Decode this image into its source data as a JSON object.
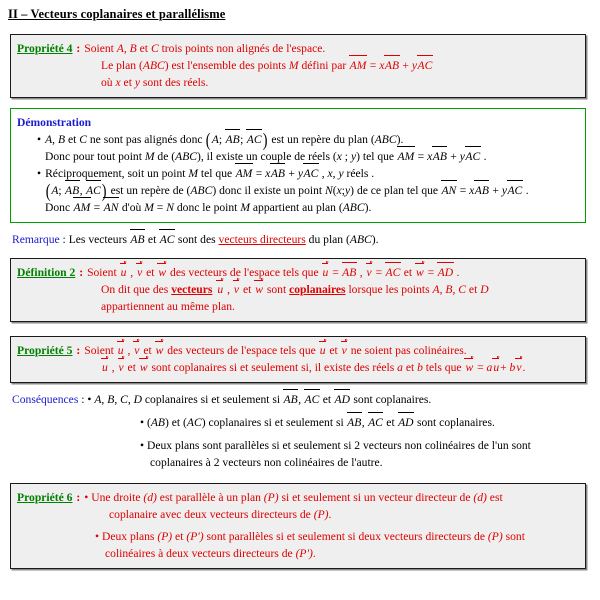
{
  "document": {
    "title": "II – Vecteurs coplanaires et parallélisme",
    "colors": {
      "label_green": "#008000",
      "body_red": "#e00000",
      "accent_blue": "#1a1ad0",
      "text_black": "#000000",
      "box_background": "#efefef",
      "box_border": "#1a1a1a",
      "demo_border": "#00a000"
    }
  },
  "propriete4": {
    "label": "Propriété 4",
    "colon": " :",
    "line1_a": "Soient ",
    "line1_A": "A",
    "line1_b": ", ",
    "line1_B": "B",
    "line1_c": " et ",
    "line1_C": "C",
    "line1_d": " trois points non alignés de l'espace.",
    "line2_a": "Le plan (",
    "line2_ABC": "ABC",
    "line2_b": ") est l'ensemble des points ",
    "line2_M": "M",
    "line2_c": " défini par ",
    "line2_AM": "AM",
    "line2_eq": " = ",
    "line2_x": "x",
    "line2_AB": "AB",
    "line2_plus": " + ",
    "line2_y": "y",
    "line2_AC": "AC",
    "line3_a": "où ",
    "line3_x": "x",
    "line3_b": " et ",
    "line3_y": "y",
    "line3_c": " sont des réels."
  },
  "demonstration": {
    "heading": "Démonstration",
    "b1_bullet": "•",
    "b1_A": "A",
    "b1_a": ", ",
    "b1_B": "B",
    "b1_b": " et ",
    "b1_C": "C",
    "b1_c": " ne sont pas alignés donc ",
    "b1_rep_A": "A",
    "b1_rep_semi1": "; ",
    "b1_rep_AB": "AB",
    "b1_rep_semi2": "; ",
    "b1_rep_AC": "AC",
    "b1_d": " est un repère du plan (",
    "b1_ABC": "ABC",
    "b1_e": ").",
    "b2_a": "Donc pour tout point ",
    "b2_M": "M",
    "b2_b": " de (",
    "b2_ABC": "ABC",
    "b2_c": "), il existe un couple de réels (",
    "b2_x": "x",
    "b2_semi": " ; ",
    "b2_y": "y",
    "b2_d": ") tel que ",
    "b2_AM": "AM",
    "b2_eq": " = ",
    "b2_xs": "x",
    "b2_AB": "AB",
    "b2_plus": " + ",
    "b2_ys": "y",
    "b2_AC": "AC",
    "b2_end": " .",
    "b3_bullet": "•",
    "b3_a": "Réciproquement, soit un point ",
    "b3_M": "M",
    "b3_b": " tel que ",
    "b3_AM": "AM",
    "b3_eq": " = ",
    "b3_x": "x",
    "b3_AB": "AB",
    "b3_plus": " + ",
    "b3_y": "y",
    "b3_AC": "AC",
    "b3_c": " , ",
    "b3_xs": "x",
    "b3_comma": ", ",
    "b3_ys": "y",
    "b3_d": " réels .",
    "b4_rep_A": "A",
    "b4_rep_semi1": "; ",
    "b4_rep_AB": "AB",
    "b4_rep_semi2": ", ",
    "b4_rep_AC": "AC",
    "b4_a": " est un repère de (",
    "b4_ABC": "ABC",
    "b4_b": ") donc il existe un point ",
    "b4_N": "N",
    "b4_c": "(",
    "b4_x": "x",
    "b4_semi": ";",
    "b4_y": "y",
    "b4_d": ")",
    "b4_e": " de ce plan tel que ",
    "b4_AN": "AN",
    "b4_eq": " = ",
    "b4_xs": "x",
    "b4_AB": "AB",
    "b4_plus": " + ",
    "b4_ys": "y",
    "b4_AC": "AC",
    "b4_end": " .",
    "b5_a": "Donc ",
    "b5_AM": "AM",
    "b5_eq": " = ",
    "b5_AN": "AN",
    "b5_b": "  d'où   ",
    "b5_M": "M",
    "b5_eq2": " = ",
    "b5_N": "N",
    "b5_c": " donc le point ",
    "b5_Ms": "M",
    "b5_d": " appartient au plan (",
    "b5_ABC": "ABC",
    "b5_e": ")."
  },
  "remarque": {
    "label": "Remarque",
    "colon": " : ",
    "a": "Les vecteurs ",
    "AB": "AB",
    "b": " et ",
    "AC": "AC",
    "c": " sont des ",
    "underlined": "vecteurs directeurs",
    "d": " du plan (",
    "ABC": "ABC",
    "e": ")."
  },
  "definition2": {
    "label": "Définition 2",
    "colon": " :",
    "l1_a": "Soient ",
    "l1_u": "u",
    "l1_c1": " , ",
    "l1_v": "v",
    "l1_b": " et ",
    "l1_w": "w",
    "l1_c": "  des vecteurs de l'espace tels que ",
    "l1_u2": "u",
    "l1_eq1": " = ",
    "l1_AB": "AB",
    "l1_c2": " , ",
    "l1_v2": "v",
    "l1_eq2": " = ",
    "l1_AC": "AC",
    "l1_d": " et ",
    "l1_w2": "w",
    "l1_eq3": " = ",
    "l1_AD": "AD",
    "l1_end": " .",
    "l2_a": "On dit que des ",
    "l2_vecteurs": "vecteurs",
    "l2_sp": " ",
    "l2_u": "u",
    "l2_c1": " , ",
    "l2_v": "v",
    "l2_b": " et ",
    "l2_w": "w",
    "l2_c": " sont ",
    "l2_coplanaires": "coplanaires",
    "l2_d": " lorsque les points ",
    "l2_A": "A",
    "l2_c2": ", ",
    "l2_B": "B",
    "l2_c3": ", ",
    "l2_C": "C",
    "l2_e": " et ",
    "l2_D": "D",
    "l3": "appartiennent au même plan."
  },
  "propriete5": {
    "label": "Propriété 5",
    "colon": " :",
    "l1_a": "Soient ",
    "l1_u": "u",
    "l1_c1": " , ",
    "l1_v": "v",
    "l1_b": " et ",
    "l1_w": "w",
    "l1_c": "  des vecteurs de l'espace tels que ",
    "l1_u2": "u",
    "l1_d": " et ",
    "l1_v2": "v",
    "l1_e": " ne soient pas colinéaires.",
    "l2_u": "u",
    "l2_c1": " , ",
    "l2_v": "v",
    "l2_a": " et ",
    "l2_w": "w",
    "l2_b": "  sont coplanaires si et seulement si, il existe des réels ",
    "l2_aa": "a",
    "l2_c": " et ",
    "l2_bb": "b",
    "l2_d": " tels que ",
    "l2_w2": "w",
    "l2_eq": " = ",
    "l2_a3": "a",
    "l2_u3": "u",
    "l2_plus": "+ ",
    "l2_b3": "b",
    "l2_v3": "v",
    "l2_end": "."
  },
  "consequences": {
    "label": "Conséquences",
    "colon": " : ",
    "b1_bullet": "•",
    "b1_a": " ",
    "b1_A": "A",
    "b1_c1": ", ",
    "b1_B": "B",
    "b1_c2": ", ",
    "b1_C": "C",
    "b1_c3": ", ",
    "b1_D": "D",
    "b1_b": " coplanaires si et seulement si ",
    "b1_AB": "AB",
    "b1_c4": ", ",
    "b1_AC": "AC",
    "b1_c": " et ",
    "b1_AD": "AD",
    "b1_d": " sont coplanaires.",
    "b2_bullet": "•",
    "b2_a": " (",
    "b2_AB": "AB",
    "b2_b": ") et (",
    "b2_AC": "AC",
    "b2_c": ") coplanaires si et seulement si ",
    "b2_v1": "AB",
    "b2_c1": ", ",
    "b2_v2": "AC",
    "b2_d": " et ",
    "b2_v3": "AD",
    "b2_e": " sont coplanaires.",
    "b3_bullet": "•",
    "b3_line1": " Deux plans sont parallèles si et seulement si 2 vecteurs non colinéaires de l'un sont",
    "b3_line2": "coplanaires à 2 vecteurs non colinéaires de l'autre."
  },
  "propriete6": {
    "label": "Propriété 6",
    "colon": " :",
    "b1_bullet": "•",
    "b1_a": " Une droite ",
    "b1_d1": "(d)",
    "b1_b": " est parallèle à un plan ",
    "b1_P": "(P)",
    "b1_c": " si et seulement si un vecteur directeur de ",
    "b1_d2": "(d)",
    "b1_d": " est",
    "b1_line2_a": "coplanaire avec deux vecteurs directeurs de ",
    "b1_line2_P": "(P)",
    "b1_line2_b": ".",
    "b2_bullet": "•",
    "b2_a": " Deux plans ",
    "b2_P": "(P)",
    "b2_b": " et ",
    "b2_Pp": "(P')",
    "b2_c": " sont parallèles si et seulement si deux vecteurs directeurs de ",
    "b2_P2": "(P)",
    "b2_d": " sont",
    "b2_line2_a": "colinéaires à deux vecteurs directeurs de ",
    "b2_line2_P": "(P')",
    "b2_line2_b": "."
  }
}
